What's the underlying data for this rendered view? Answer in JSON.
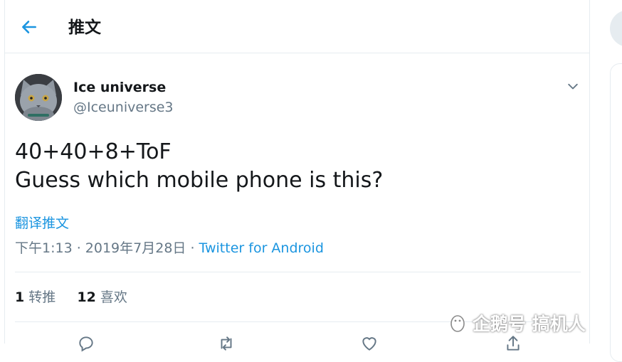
{
  "colors": {
    "accent": "#1b95e0",
    "secondary_text": "#657786",
    "border": "#e6ecf0"
  },
  "header": {
    "back_icon": "arrow-left-icon",
    "title": "推文"
  },
  "author": {
    "name": "Ice universe",
    "handle": "@Iceuniverse3",
    "avatar": "cat-avatar"
  },
  "tweet": {
    "text": "40+40+8+ToF\nGuess which mobile phone is this?",
    "translate_label": "翻译推文",
    "timestamp": "下午1:13 · 2019年7月28日 · ",
    "source": "Twitter for Android"
  },
  "stats": {
    "retweets_count": "1",
    "retweets_label": "转推",
    "likes_count": "12",
    "likes_label": "喜欢"
  },
  "actions": [
    "reply-icon",
    "retweet-icon",
    "like-icon",
    "share-icon"
  ],
  "watermark": {
    "text": "企鹅号 搞机人"
  }
}
